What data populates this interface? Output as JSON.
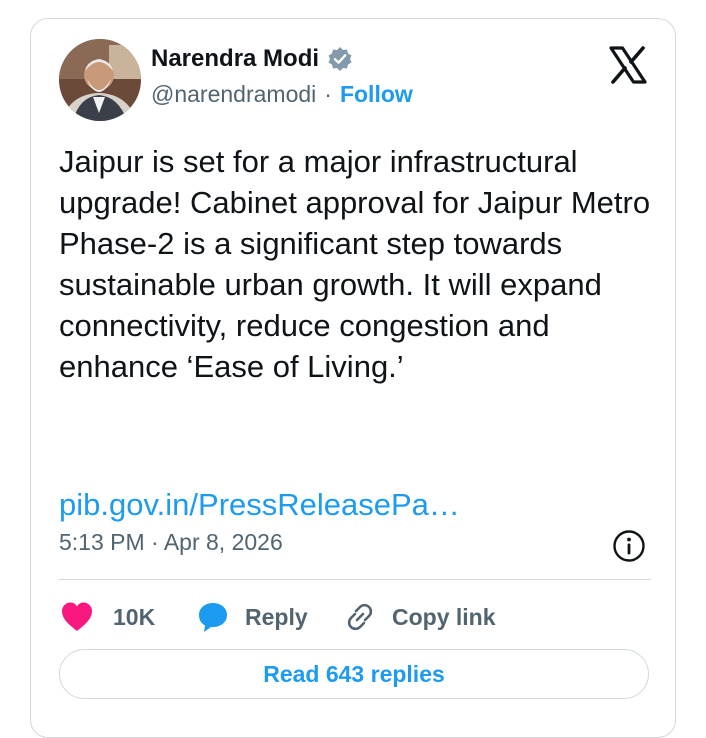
{
  "author": {
    "name": "Narendra Modi",
    "handle": "@narendramodi",
    "separator": "·",
    "follow_label": "Follow"
  },
  "icons": {
    "avatar": "profile-photo",
    "verified": "verified-badge-icon",
    "platform": "x-logo-icon",
    "info": "info-icon",
    "like": "heart-icon",
    "reply": "speech-bubble-icon",
    "copy": "link-icon"
  },
  "tweet": {
    "text": "Jaipur is set for a major infrastructural upgrade! Cabinet approval for Jaipur Metro Phase-2 is a significant step towards sustainable urban growth. It will expand connectivity, reduce congestion and enhance ‘Ease of Living.’",
    "link": "pib.gov.in/PressReleasePa…",
    "timestamp": "5:13 PM · Apr 8, 2026"
  },
  "actions": {
    "likes": "10K",
    "reply_label": "Reply",
    "copy_label": "Copy link"
  },
  "footer": {
    "read_replies": "Read 643 replies"
  },
  "colors": {
    "accent": "#1d9bf0",
    "like": "#f91880",
    "text": "#0f1419",
    "muted": "#536471",
    "border": "#cfd9de"
  }
}
